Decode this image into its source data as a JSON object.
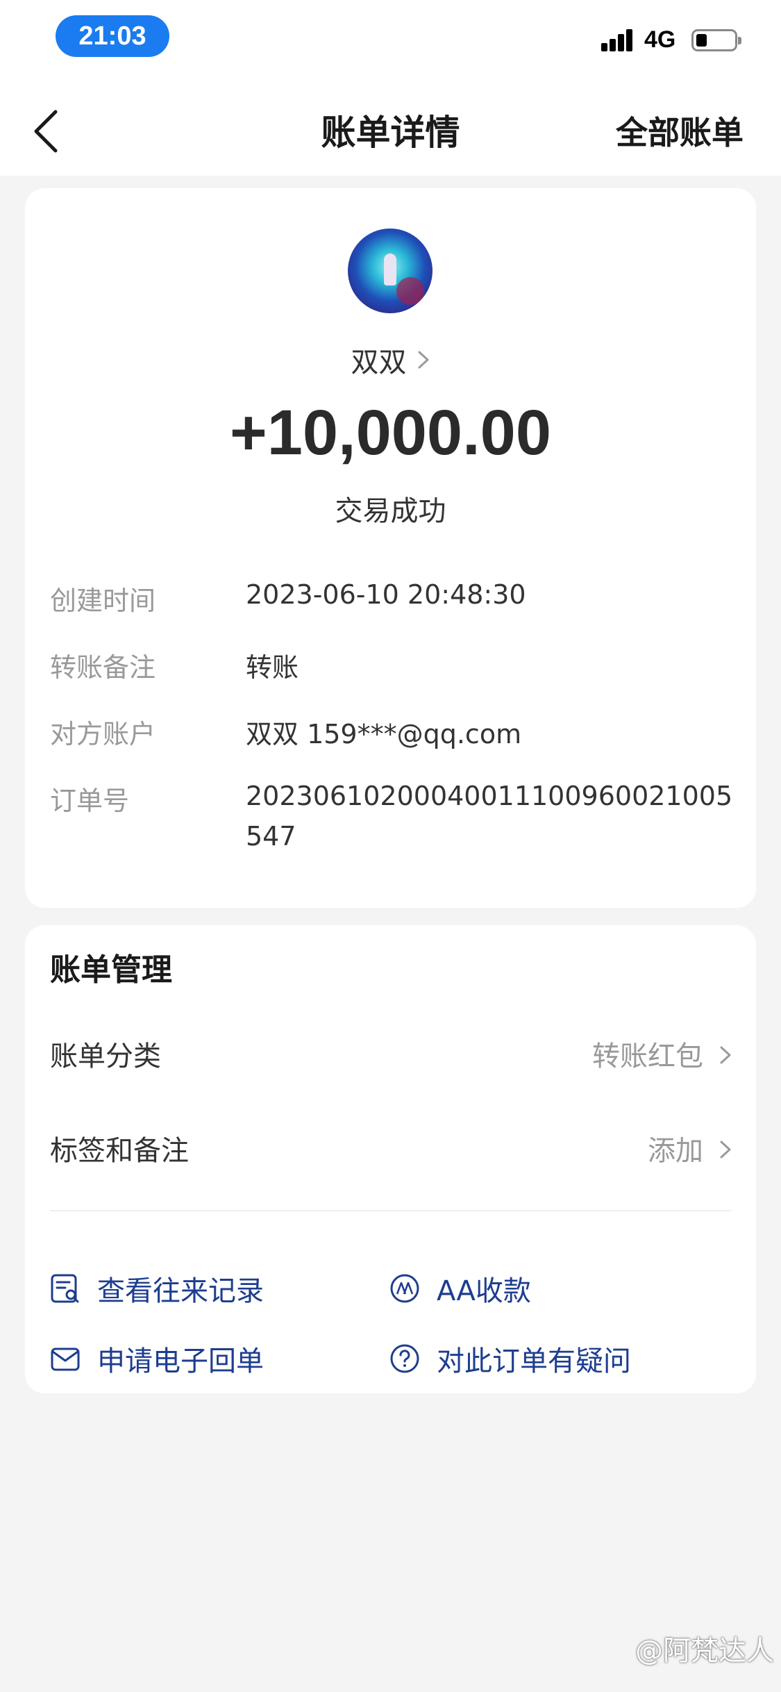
{
  "status_bar": {
    "time": "21:03",
    "network": "4G"
  },
  "navbar": {
    "title": "账单详情",
    "right_label": "全部账单"
  },
  "transaction": {
    "name": "双双",
    "amount": "+10,000.00",
    "status": "交易成功",
    "details": [
      {
        "label": "创建时间",
        "value": "2023-06-10 20:48:30"
      },
      {
        "label": "转账备注",
        "value": "转账"
      },
      {
        "label": "对方账户",
        "value": "双双 159***@qq.com"
      },
      {
        "label": "订单号",
        "value": "20230610200040011100960021005547"
      }
    ]
  },
  "management": {
    "title": "账单管理",
    "rows": [
      {
        "label": "账单分类",
        "value": "转账红包"
      },
      {
        "label": "标签和备注",
        "value": "添加"
      }
    ],
    "actions": [
      {
        "label": "查看往来记录",
        "icon": "records-icon"
      },
      {
        "label": "AA收款",
        "icon": "aa-icon"
      },
      {
        "label": "申请电子回单",
        "icon": "mail-icon"
      },
      {
        "label": "对此订单有疑问",
        "icon": "question-icon"
      }
    ]
  },
  "watermark": "@阿梵达人",
  "colors": {
    "accent": "#1a7cf0",
    "link": "#1d3d8f",
    "muted": "#999999",
    "background": "#f4f4f5"
  }
}
